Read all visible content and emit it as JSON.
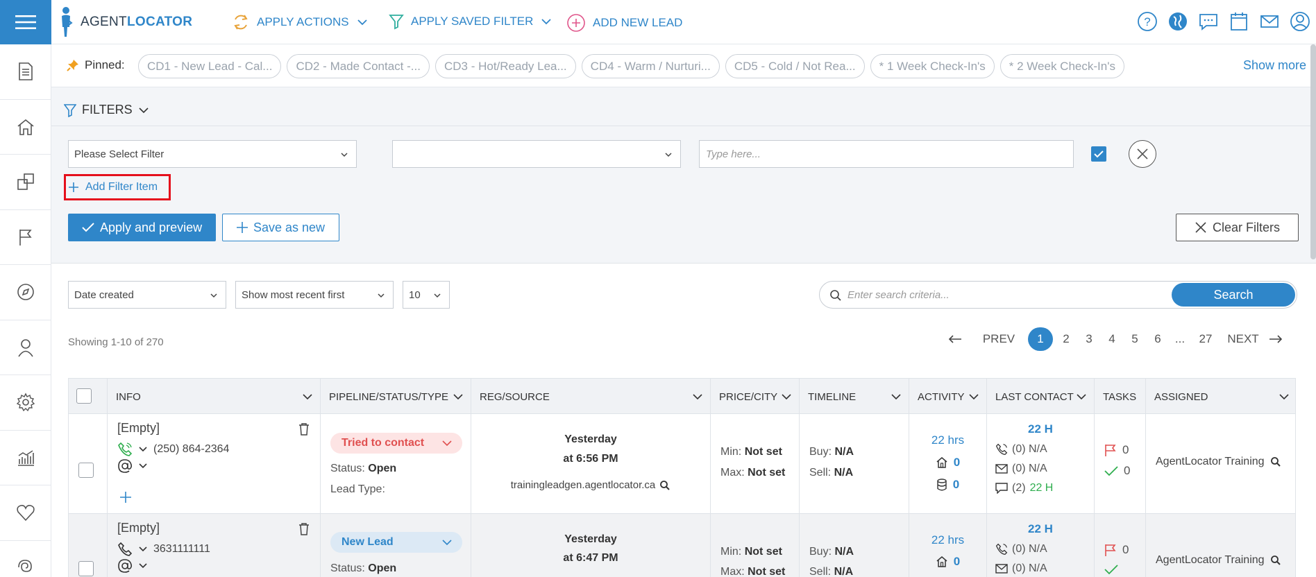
{
  "app": {
    "brand_part1": "AGENT",
    "brand_part2": "LOCATOR"
  },
  "colors": {
    "accent": "#2f86c9",
    "danger": "#e5101c",
    "pill_red_bg": "#fde4e4",
    "pill_blue_bg": "#dce9f5",
    "green": "#2fae4e"
  },
  "topnav": {
    "apply_actions": "APPLY ACTIONS",
    "apply_saved_filter": "APPLY SAVED FILTER",
    "add_new_lead": "ADD NEW LEAD",
    "icons": [
      "help-icon",
      "globe-icon",
      "chat-icon",
      "calendar-icon",
      "mail-icon",
      "user-icon"
    ]
  },
  "sidebar": {
    "icons": [
      "document-icon",
      "home-icon",
      "copy-icon",
      "flag-icon",
      "compass-icon",
      "person-icon",
      "gear-icon",
      "analytics-icon",
      "heart-icon",
      "spiral-icon"
    ]
  },
  "pinned": {
    "label": "Pinned:",
    "items": [
      "CD1 - New Lead - Cal...",
      "CD2 - Made Contact -...",
      "CD3 - Hot/Ready Lea...",
      "CD4 - Warm / Nurturi...",
      "CD5 - Cold / Not Rea...",
      "* 1 Week Check-In's",
      "* 2 Week Check-In's"
    ],
    "show_more": "Show more"
  },
  "filters": {
    "title": "FILTERS",
    "filter_select": "Please Select Filter",
    "operator_select": "",
    "value_placeholder": "Type here...",
    "add_filter_item": "Add Filter Item",
    "apply_preview": "Apply and preview",
    "save_as_new": "Save as new",
    "clear_filters": "Clear Filters"
  },
  "list": {
    "sort_field": "Date created",
    "sort_order": "Show most recent first",
    "page_size": "10",
    "search_placeholder": "Enter search criteria...",
    "search_button": "Search",
    "showing": "Showing 1-10 of 270",
    "pager": {
      "prev": "PREV",
      "next": "NEXT",
      "pages": [
        "1",
        "2",
        "3",
        "4",
        "5",
        "6",
        "...",
        "27"
      ],
      "current": "1"
    }
  },
  "table": {
    "headers": [
      "INFO",
      "PIPELINE/STATUS/TYPE",
      "REG/SOURCE",
      "PRICE/CITY",
      "TIMELINE",
      "ACTIVITY",
      "LAST CONTACT",
      "TASKS",
      "ASSIGNED"
    ],
    "rows": [
      {
        "name": "[Empty]",
        "phone": "(250) 864-2364",
        "stage": "Tried to contact",
        "stage_color": "red",
        "status_label": "Status:",
        "status": "Open",
        "lead_type_label": "Lead Type:",
        "reg_day": "Yesterday",
        "reg_time": "at 6:56 PM",
        "source": "trainingleadgen.agentlocator.ca",
        "min_label": "Min:",
        "min": "Not set",
        "max_label": "Max:",
        "max": "Not set",
        "buy_label": "Buy:",
        "buy": "N/A",
        "sell_label": "Sell:",
        "sell": "N/A",
        "activity_time": "22 hrs",
        "activity_views": "0",
        "activity_saves": "0",
        "last_contact": "22 H",
        "lc_calls": "(0) N/A",
        "lc_emails": "(0) N/A",
        "lc_texts_count": "(2)",
        "lc_texts_time": "22 H",
        "tasks_flag": "0",
        "tasks_done": "0",
        "assigned": "AgentLocator Training"
      },
      {
        "name": "[Empty]",
        "phone": "3631111111",
        "stage": "New Lead",
        "stage_color": "blue",
        "status_label": "Status:",
        "status": "Open",
        "reg_day": "Yesterday",
        "reg_time": "at 6:47 PM",
        "min_label": "Min:",
        "min": "Not set",
        "max_label": "Max:",
        "max": "Not set",
        "buy_label": "Buy:",
        "buy": "N/A",
        "sell_label": "Sell:",
        "sell": "N/A",
        "activity_time": "22 hrs",
        "activity_views": "0",
        "last_contact": "22 H",
        "lc_calls": "(0) N/A",
        "lc_emails": "(0) N/A",
        "tasks_flag": "0",
        "tasks_done": "",
        "assigned": "AgentLocator Training"
      }
    ]
  }
}
